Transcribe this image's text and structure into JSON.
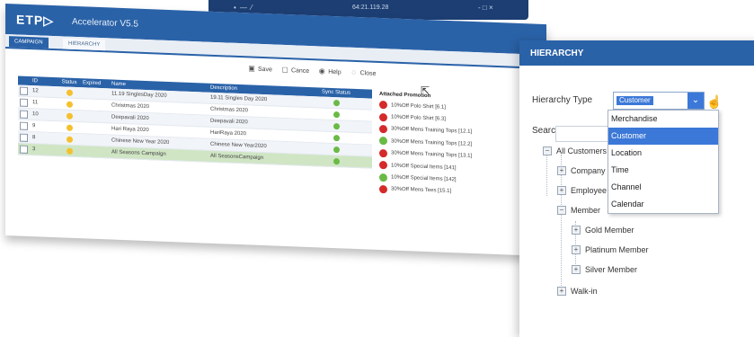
{
  "topbar": {
    "left_glyphs": "• — ⁄",
    "center": "64:21.119.28",
    "right_glyphs": "- □ ×"
  },
  "app": {
    "logo": "ETP▷",
    "title": "Accelerator V5.5"
  },
  "tabs": [
    "CAMPAIGN",
    "HIERARCHY"
  ],
  "toolbar": {
    "save": "Save",
    "cancel": "Cance",
    "help": "Help",
    "close": "Close"
  },
  "grid": {
    "columns": [
      "ID",
      "Status",
      "Expired",
      "Name",
      "Description",
      "Sync Status"
    ],
    "rows": [
      {
        "id": "12",
        "name": "11.19 SinglesDay 2020",
        "description": "19.11 Singles Day 2020",
        "status_color": "#f5c02c",
        "sync_color": "#6aba45"
      },
      {
        "id": "11",
        "name": "Christmas 2020",
        "description": "Christmas 2020",
        "status_color": "#f5c02c",
        "sync_color": "#6aba45"
      },
      {
        "id": "10",
        "name": "Deepavali 2020",
        "description": "Deepavali 2020",
        "status_color": "#f5c02c",
        "sync_color": "#6aba45"
      },
      {
        "id": "9",
        "name": "Hari Raya 2020",
        "description": "HariRaya 2020",
        "status_color": "#f5c02c",
        "sync_color": "#6aba45"
      },
      {
        "id": "8",
        "name": "Chinese New Year 2020",
        "description": "Chinese New Year2020",
        "status_color": "#f5c02c",
        "sync_color": "#6aba45"
      },
      {
        "id": "3",
        "name": "All Seasons Campaign",
        "description": "All SeasonsCampaign",
        "status_color": "#f5c02c",
        "sync_color": "#6aba45"
      }
    ]
  },
  "promotions": {
    "header": "Attached Promotion",
    "items": [
      {
        "label": "10%Off Polo Shirt [6.1]",
        "color": "#d42a2a"
      },
      {
        "label": "10%Off Polo Shirt [6.3]",
        "color": "#d42a2a"
      },
      {
        "label": "30%Off Mens Training Tops [12.1]",
        "color": "#d42a2a"
      },
      {
        "label": "30%Off Mens Training Tops [12.2]",
        "color": "#6aba45"
      },
      {
        "label": "30%Off Mens Training Tops [13.1]",
        "color": "#d42a2a"
      },
      {
        "label": "10%Off Special Items [141]",
        "color": "#d42a2a"
      },
      {
        "label": "10%Off Special Items [142]",
        "color": "#6aba45"
      },
      {
        "label": "30%Off Mens Tees [15.1]",
        "color": "#d42a2a"
      }
    ]
  },
  "hierarchy": {
    "title": "HIERARCHY",
    "type_label": "Hierarchy Type",
    "type_value": "Customer",
    "options": [
      "Merchandise",
      "Customer",
      "Location",
      "Time",
      "Channel",
      "Calendar"
    ],
    "selected_index": 1,
    "search_label": "Search",
    "tree": {
      "root": "All Customers",
      "children": [
        "Company",
        "Employee",
        "Member"
      ],
      "member_children": [
        "Gold Member",
        "Platinum Member",
        "Silver Member"
      ],
      "last": "Walk-in"
    }
  },
  "colors": {
    "brand": "#2a62a8",
    "accent": "#3b78d8"
  }
}
